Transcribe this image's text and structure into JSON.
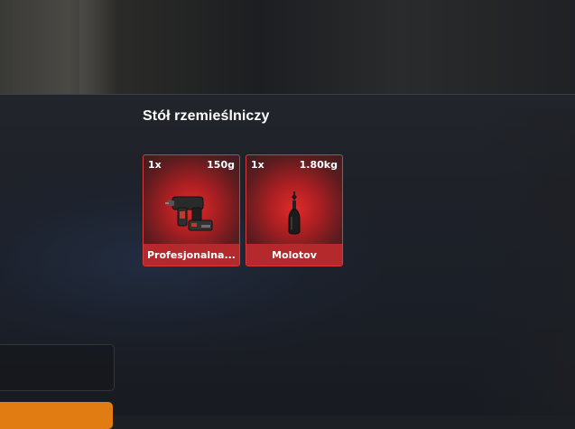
{
  "panel": {
    "title": "Stół rzemieślniczy"
  },
  "items": [
    {
      "quantity": "1x",
      "weight": "150g",
      "name": "Profesjonalna...",
      "icon": "hammer-drill-icon"
    },
    {
      "quantity": "1x",
      "weight": "1.80kg",
      "name": "Molotov",
      "icon": "molotov-bottle-icon"
    }
  ],
  "colors": {
    "slot_border": "#d93a3a",
    "slot_label_bg": "#b3292c",
    "accent_button": "#e07c12"
  }
}
